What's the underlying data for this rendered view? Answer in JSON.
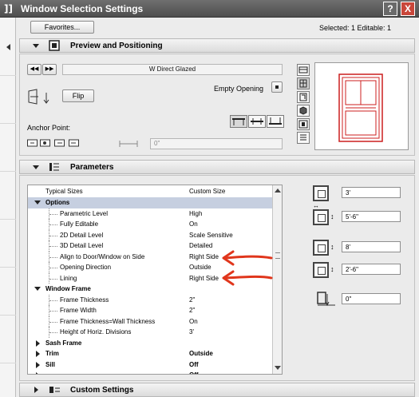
{
  "window": {
    "title_icon": "]]",
    "title": "Window Selection Settings",
    "help_label": "?",
    "close_label": "X"
  },
  "toolbar": {
    "favorites_label": "Favorites...",
    "selection_status": "Selected: 1 Editable: 1"
  },
  "preview": {
    "section_title": "Preview and Positioning",
    "prev_label": "◀◀",
    "next_label": "▶▶",
    "object_name": "W Direct Glazed",
    "empty_opening_label": "Empty Opening",
    "flip_label": "Flip",
    "anchor_point_label": "Anchor Point:",
    "offset_value": "0\""
  },
  "parameters": {
    "section_title": "Parameters",
    "header": {
      "label": "Typical Sizes",
      "value": "Custom Size"
    },
    "rows": [
      {
        "label": "Options",
        "value": "",
        "kind": "group-open-selected"
      },
      {
        "label": "Parametric Level",
        "value": "High",
        "kind": "child"
      },
      {
        "label": "Fully Editable",
        "value": "On",
        "kind": "child"
      },
      {
        "label": "2D Detail Level",
        "value": "Scale Sensitive",
        "kind": "child"
      },
      {
        "label": "3D Detail Level",
        "value": "Detailed",
        "kind": "child"
      },
      {
        "label": "Align to Door/Window on Side",
        "value": "Right Side",
        "kind": "child"
      },
      {
        "label": "Opening Direction",
        "value": "Outside",
        "kind": "child"
      },
      {
        "label": "Lining",
        "value": "Right Side",
        "kind": "child"
      },
      {
        "label": "Window Frame",
        "value": "",
        "kind": "group-open"
      },
      {
        "label": "Frame Thickness",
        "value": "2\"",
        "kind": "child"
      },
      {
        "label": "Frame Width",
        "value": "2\"",
        "kind": "child"
      },
      {
        "label": "Frame Thickness=Wall Thickness",
        "value": "On",
        "kind": "child"
      },
      {
        "label": "Height of Horiz. Divisions",
        "value": "3'",
        "kind": "child"
      },
      {
        "label": "Sash Frame",
        "value": "",
        "kind": "group-closed"
      },
      {
        "label": "Trim",
        "value": "Outside",
        "kind": "group-closed"
      },
      {
        "label": "Sill",
        "value": "Off",
        "kind": "group-closed"
      },
      {
        "label": "",
        "value": "Off",
        "kind": "group-closed"
      }
    ],
    "dimensions": [
      {
        "name": "width",
        "value": "3'"
      },
      {
        "name": "height",
        "value": "5'-6\""
      },
      {
        "name": "sill-width",
        "value": "8'"
      },
      {
        "name": "sill-height",
        "value": "2'-6\""
      },
      {
        "name": "sill-offset",
        "value": "0\""
      }
    ]
  },
  "custom_settings": {
    "section_title": "Custom Settings"
  },
  "colors": {
    "accent_red": "#e0361c",
    "title_bar": "#5a5a5a",
    "selected_row": "#c6cfe0",
    "window_preview_red": "#cc1f1f"
  }
}
